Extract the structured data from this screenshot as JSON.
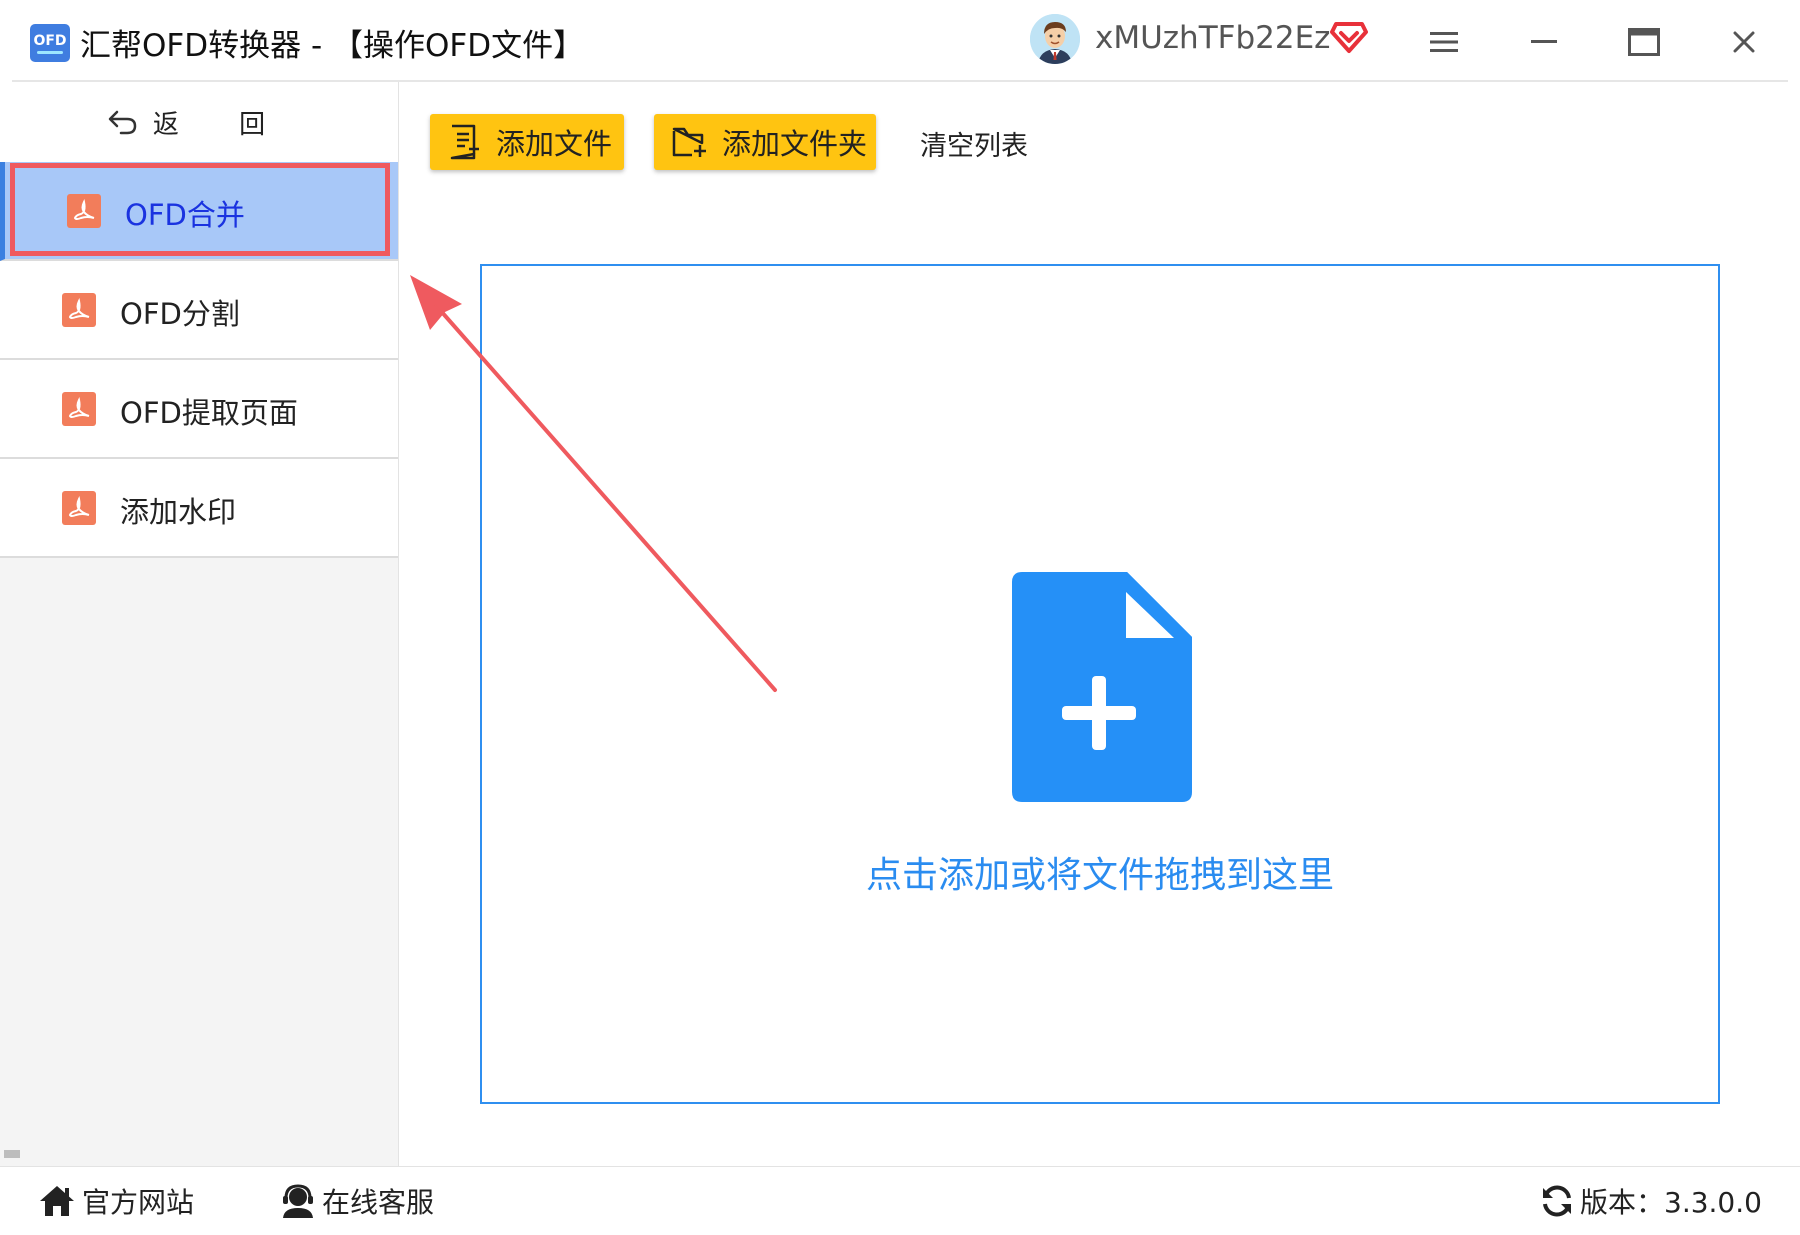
{
  "window": {
    "logo_text": "OFD",
    "title": "汇帮OFD转换器 - 【操作OFD文件】",
    "username": "xMUzhTFb22Ez"
  },
  "sidebar": {
    "back_label": "返 回",
    "items": [
      {
        "label": "OFD合并",
        "active": true
      },
      {
        "label": "OFD分割",
        "active": false
      },
      {
        "label": "OFD提取页面",
        "active": false
      },
      {
        "label": "添加水印",
        "active": false
      }
    ]
  },
  "toolbar": {
    "add_file_label": "添加文件",
    "add_folder_label": "添加文件夹",
    "clear_list_label": "清空列表"
  },
  "dropzone": {
    "hint": "点击添加或将文件拖拽到这里"
  },
  "footer": {
    "website_label": "官方网站",
    "support_label": "在线客服",
    "version_label": "版本：3.3.0.0"
  },
  "colors": {
    "accent_blue": "#2a8cf0",
    "toolbar_yellow": "#ffc411",
    "active_item_bg": "#a8c8f8",
    "highlight_red": "#ef5a5f",
    "pdf_icon_orange": "#f27d5b"
  }
}
